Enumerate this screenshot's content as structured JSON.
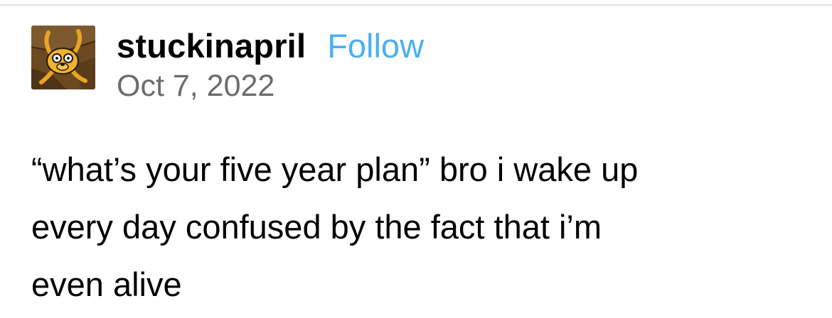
{
  "post": {
    "author": {
      "username": "stuckinapril",
      "avatar_icon": "jake-the-dog-avatar-icon"
    },
    "follow_label": "Follow",
    "date": "Oct 7, 2022",
    "body_lines": [
      "“what’s your five year plan” bro i wake up",
      "every day confused by the fact that i’m",
      "even alive"
    ]
  },
  "colors": {
    "follow_link": "#4aaff2",
    "date_text": "#6c6c6c",
    "divider": "#e2e2e2"
  }
}
